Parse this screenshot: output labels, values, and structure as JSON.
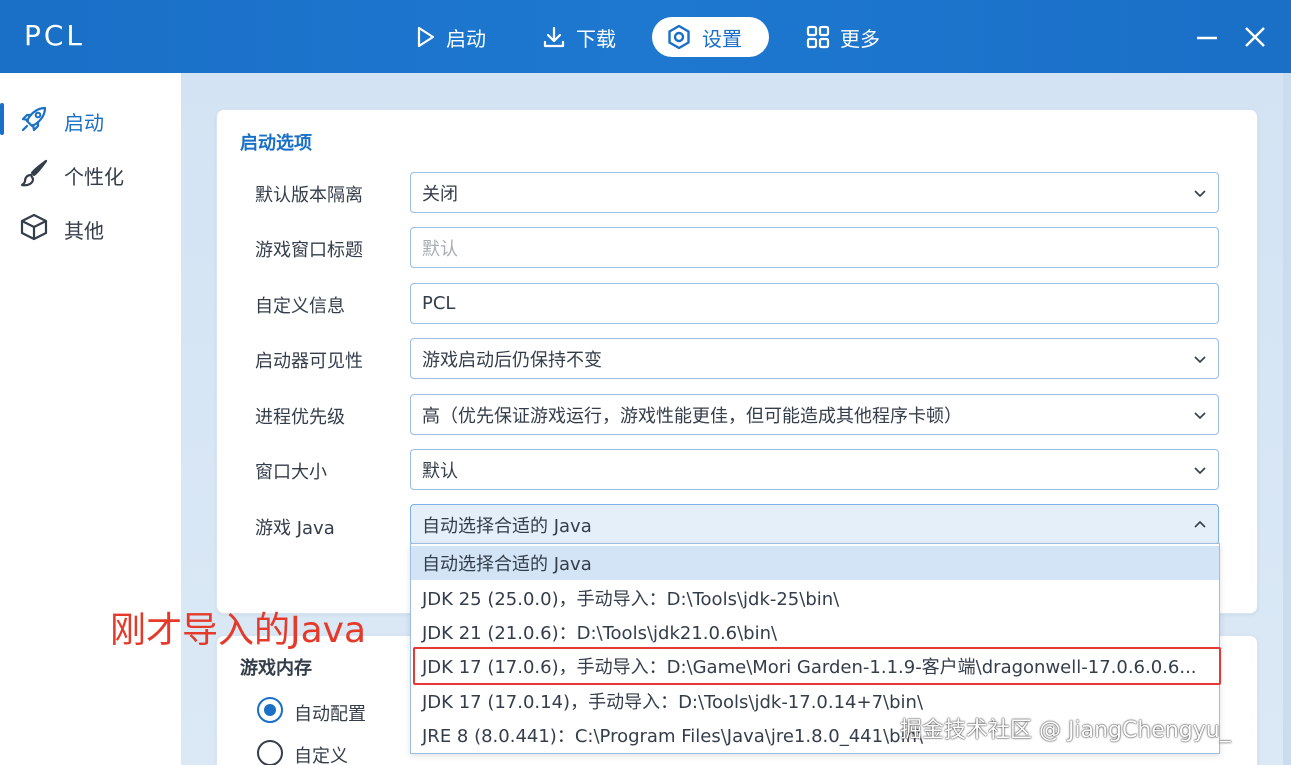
{
  "app": {
    "title": "PCL"
  },
  "nav": {
    "tabs": [
      {
        "label": "启动",
        "icon": "play-icon"
      },
      {
        "label": "下载",
        "icon": "download-icon"
      },
      {
        "label": "设置",
        "icon": "settings-icon",
        "active": true
      },
      {
        "label": "更多",
        "icon": "grid-icon"
      }
    ]
  },
  "sidebar": {
    "items": [
      {
        "label": "启动",
        "icon": "rocket-icon",
        "active": true
      },
      {
        "label": "个性化",
        "icon": "brush-icon"
      },
      {
        "label": "其他",
        "icon": "box-icon"
      }
    ]
  },
  "launch_options": {
    "title": "启动选项",
    "rows": [
      {
        "label": "默认版本隔离",
        "value": "关闭",
        "type": "select"
      },
      {
        "label": "游戏窗口标题",
        "placeholder": "默认",
        "type": "text"
      },
      {
        "label": "自定义信息",
        "value": "PCL",
        "type": "text"
      },
      {
        "label": "启动器可见性",
        "value": "游戏启动后仍保持不变",
        "type": "select"
      },
      {
        "label": "进程优先级",
        "value": "高（优先保证游戏运行，游戏性能更佳，但可能造成其他程序卡顿）",
        "type": "select"
      },
      {
        "label": "窗口大小",
        "value": "默认",
        "type": "select"
      },
      {
        "label": "游戏 Java",
        "value": "自动选择合适的 Java",
        "type": "select",
        "open": true
      }
    ]
  },
  "java_dropdown": {
    "options": [
      "自动选择合适的 Java",
      "JDK 25 (25.0.0)，手动导入：D:\\Tools\\jdk-25\\bin\\",
      "JDK 21 (21.0.6)：D:\\Tools\\jdk21.0.6\\bin\\",
      "JDK 17 (17.0.6)，手动导入：D:\\Game\\Mori Garden-1.1.9-客户端\\dragonwell-17.0.6.0.6...",
      "JDK 17 (17.0.14)，手动导入：D:\\Tools\\jdk-17.0.14+7\\bin\\",
      "JRE 8 (8.0.441)：C:\\Program Files\\Java\\jre1.8.0_441\\bin\\"
    ],
    "selected_index": 0,
    "highlighted_index": 3
  },
  "annotation": {
    "text": "刚才导入的Java"
  },
  "game_memory": {
    "title": "游戏内存",
    "options": [
      {
        "label": "自动配置",
        "checked": true
      },
      {
        "label": "自定义",
        "checked": false
      }
    ]
  },
  "watermark": {
    "text": "掘金技术社区 @ JiangChengyu_"
  },
  "colors": {
    "accent": "#1a6fc6",
    "annotation": "#e5392a"
  }
}
